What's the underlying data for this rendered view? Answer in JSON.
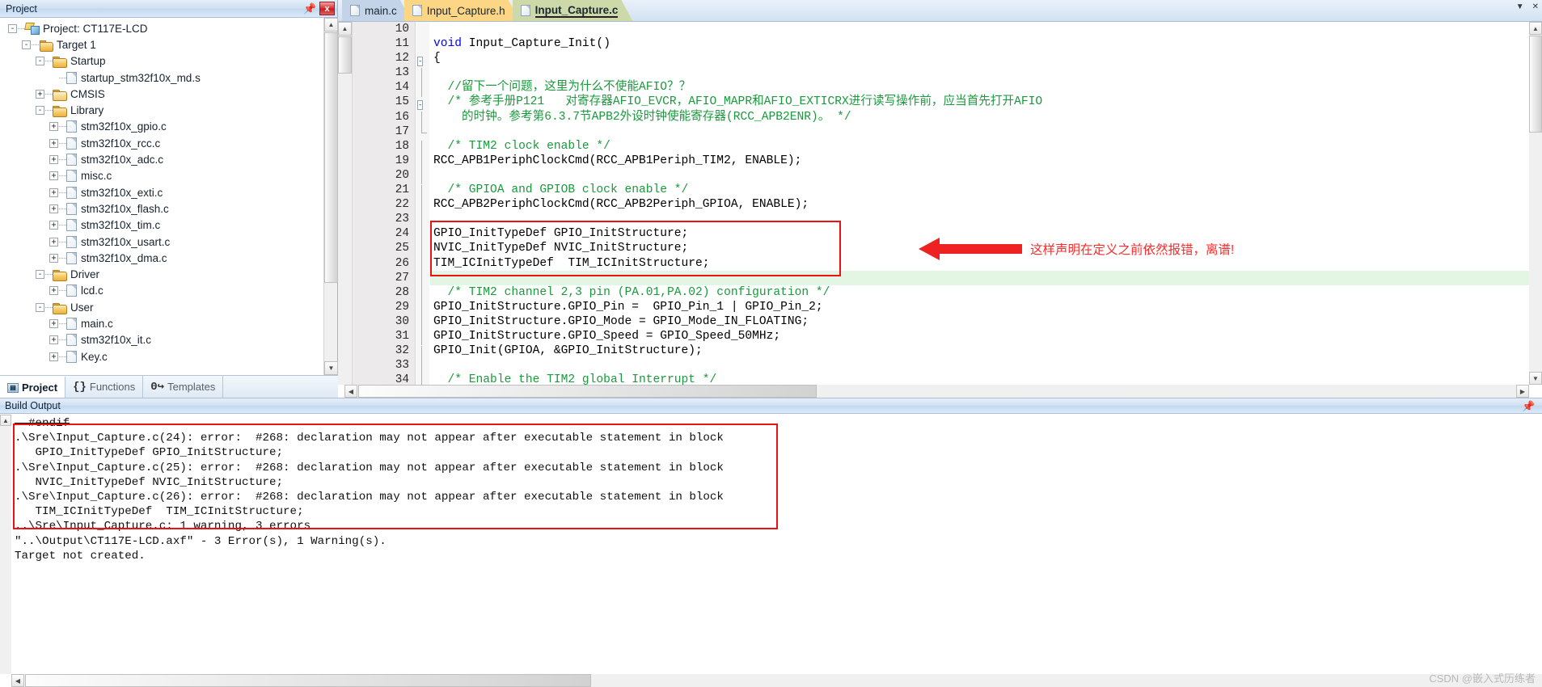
{
  "project_pane": {
    "title": "Project",
    "pin_icon": "pin-icon",
    "close_label": "x",
    "tree": [
      {
        "depth": 0,
        "icon": "project",
        "label": "Project: CT117E-LCD",
        "expander": "-"
      },
      {
        "depth": 1,
        "icon": "target",
        "label": "Target 1",
        "expander": "-"
      },
      {
        "depth": 2,
        "icon": "folder",
        "label": "Startup",
        "expander": "-"
      },
      {
        "depth": 3,
        "icon": "file",
        "label": "startup_stm32f10x_md.s",
        "expander": ""
      },
      {
        "depth": 2,
        "icon": "folder-closed",
        "label": "CMSIS",
        "expander": "+"
      },
      {
        "depth": 2,
        "icon": "folder",
        "label": "Library",
        "expander": "-"
      },
      {
        "depth": 3,
        "icon": "file",
        "label": "stm32f10x_gpio.c",
        "expander": "+"
      },
      {
        "depth": 3,
        "icon": "file",
        "label": "stm32f10x_rcc.c",
        "expander": "+"
      },
      {
        "depth": 3,
        "icon": "file",
        "label": "stm32f10x_adc.c",
        "expander": "+"
      },
      {
        "depth": 3,
        "icon": "file",
        "label": "misc.c",
        "expander": "+"
      },
      {
        "depth": 3,
        "icon": "file",
        "label": "stm32f10x_exti.c",
        "expander": "+"
      },
      {
        "depth": 3,
        "icon": "file",
        "label": "stm32f10x_flash.c",
        "expander": "+"
      },
      {
        "depth": 3,
        "icon": "file",
        "label": "stm32f10x_tim.c",
        "expander": "+"
      },
      {
        "depth": 3,
        "icon": "file",
        "label": "stm32f10x_usart.c",
        "expander": "+"
      },
      {
        "depth": 3,
        "icon": "file",
        "label": "stm32f10x_dma.c",
        "expander": "+"
      },
      {
        "depth": 2,
        "icon": "folder",
        "label": "Driver",
        "expander": "-"
      },
      {
        "depth": 3,
        "icon": "file",
        "label": "lcd.c",
        "expander": "+"
      },
      {
        "depth": 2,
        "icon": "folder",
        "label": "User",
        "expander": "-"
      },
      {
        "depth": 3,
        "icon": "file",
        "label": "main.c",
        "expander": "+"
      },
      {
        "depth": 3,
        "icon": "file",
        "label": "stm32f10x_it.c",
        "expander": "+"
      },
      {
        "depth": 3,
        "icon": "file",
        "label": "Key.c",
        "expander": "+"
      }
    ],
    "bottom_tabs": [
      {
        "label": "Project",
        "icon": "project-tab-icon",
        "active": true
      },
      {
        "label": "Functions",
        "icon": "braces-icon",
        "active": false
      },
      {
        "label": "Templates",
        "icon": "templates-icon",
        "active": false
      }
    ]
  },
  "editor": {
    "tabs": [
      {
        "label": "main.c",
        "state": "inactive-blue"
      },
      {
        "label": "Input_Capture.h",
        "state": "inactive-yellow"
      },
      {
        "label": "Input_Capture.c",
        "state": "active"
      }
    ],
    "nav": {
      "down_icon": "chevron-down-icon",
      "close_icon": "close-icon"
    },
    "lines": [
      {
        "no": "10",
        "fold": "none",
        "text": ""
      },
      {
        "no": "11",
        "fold": "none",
        "segments": [
          {
            "t": "void ",
            "c": "kw"
          },
          {
            "t": "Input_Capture_Init()",
            "c": ""
          }
        ]
      },
      {
        "no": "12",
        "fold": "minus",
        "segments": [
          {
            "t": "{",
            "c": ""
          }
        ]
      },
      {
        "no": "13",
        "fold": "bar",
        "segments": []
      },
      {
        "no": "14",
        "fold": "bar",
        "segments": [
          {
            "t": "  //留下一个问题，这里为什么不使能AFIO？？",
            "c": "cmt"
          }
        ]
      },
      {
        "no": "15",
        "fold": "minus",
        "segments": [
          {
            "t": "  /* 参考手册P121   对寄存器AFIO_EVCR，AFIO_MAPR和AFIO_EXTICRX进行读写操作前，应当首先打开AFIO",
            "c": "cmt"
          }
        ]
      },
      {
        "no": "16",
        "fold": "bar",
        "segments": [
          {
            "t": "    的时钟。参考第6.3.7节APB2外设时钟使能寄存器(RCC_APB2ENR)。 */",
            "c": "cmt"
          }
        ]
      },
      {
        "no": "17",
        "fold": "end",
        "segments": []
      },
      {
        "no": "18",
        "fold": "bar",
        "segments": [
          {
            "t": "  /* TIM2 clock enable */",
            "c": "cmt"
          }
        ]
      },
      {
        "no": "19",
        "fold": "bar",
        "segments": [
          {
            "t": "RCC_APB1PeriphClockCmd(RCC_APB1Periph_TIM2, ENABLE);",
            "c": ""
          }
        ]
      },
      {
        "no": "20",
        "fold": "bar",
        "segments": []
      },
      {
        "no": "21",
        "fold": "bar",
        "segments": [
          {
            "t": "  /* GPIOA and GPIOB clock enable */",
            "c": "cmt"
          }
        ]
      },
      {
        "no": "22",
        "fold": "bar",
        "segments": [
          {
            "t": "RCC_APB2PeriphClockCmd(RCC_APB2Periph_GPIOA, ENABLE);",
            "c": ""
          }
        ]
      },
      {
        "no": "23",
        "fold": "bar",
        "segments": []
      },
      {
        "no": "24",
        "fold": "bar",
        "segments": [
          {
            "t": "GPIO_InitTypeDef GPIO_InitStructure;",
            "c": ""
          }
        ]
      },
      {
        "no": "25",
        "fold": "bar",
        "segments": [
          {
            "t": "NVIC_InitTypeDef NVIC_InitStructure;",
            "c": ""
          }
        ]
      },
      {
        "no": "26",
        "fold": "bar",
        "segments": [
          {
            "t": "TIM_ICInitTypeDef  TIM_ICInitStructure;",
            "c": ""
          }
        ]
      },
      {
        "no": "27",
        "fold": "bar",
        "segments": [],
        "highlight": true
      },
      {
        "no": "28",
        "fold": "bar",
        "segments": [
          {
            "t": "  /* TIM2 channel 2,3 pin (PA.01,PA.02) configuration */",
            "c": "cmt"
          }
        ]
      },
      {
        "no": "29",
        "fold": "bar",
        "segments": [
          {
            "t": "GPIO_InitStructure.GPIO_Pin =  GPIO_Pin_1 | GPIO_Pin_2;",
            "c": ""
          }
        ]
      },
      {
        "no": "30",
        "fold": "bar",
        "segments": [
          {
            "t": "GPIO_InitStructure.GPIO_Mode = GPIO_Mode_IN_FLOATING;",
            "c": ""
          }
        ]
      },
      {
        "no": "31",
        "fold": "bar",
        "segments": [
          {
            "t": "GPIO_InitStructure.GPIO_Speed = GPIO_Speed_50MHz;",
            "c": ""
          }
        ]
      },
      {
        "no": "32",
        "fold": "bar",
        "segments": [
          {
            "t": "GPIO_Init(GPIOA, &GPIO_InitStructure);",
            "c": ""
          }
        ]
      },
      {
        "no": "33",
        "fold": "bar",
        "segments": []
      },
      {
        "no": "34",
        "fold": "bar",
        "segments": [
          {
            "t": "  /* Enable the TIM2 global Interrupt */",
            "c": "cmt"
          }
        ]
      }
    ],
    "annotation": {
      "note": "这样声明在定义之前依然报错，离谱!",
      "note_color": "#ff2a2a",
      "box_color": "#ee1111",
      "arrow_icon": "left-arrow-icon"
    }
  },
  "build_output": {
    "title": "Build Output",
    "pin_icon": "pin-icon",
    "lines": [
      {
        "text": "  #endif",
        "strike": true
      },
      {
        "text": ".\\Sre\\Input_Capture.c(24): error:  #268: declaration may not appear after executable statement in block"
      },
      {
        "text": "   GPIO_InitTypeDef GPIO_InitStructure;"
      },
      {
        "text": ".\\Sre\\Input_Capture.c(25): error:  #268: declaration may not appear after executable statement in block"
      },
      {
        "text": "   NVIC_InitTypeDef NVIC_InitStructure;"
      },
      {
        "text": ".\\Sre\\Input_Capture.c(26): error:  #268: declaration may not appear after executable statement in block"
      },
      {
        "text": "   TIM_ICInitTypeDef  TIM_ICInitStructure;"
      },
      {
        "text": "..\\Sre\\Input_Capture.c: 1 warning, 3 errors"
      },
      {
        "text": "\"..\\Output\\CT117E-LCD.axf\" - 3 Error(s), 1 Warning(s)."
      },
      {
        "text": "Target not created."
      }
    ],
    "box_color": "#ee1111"
  },
  "watermark": "CSDN @嵌入式历练者"
}
